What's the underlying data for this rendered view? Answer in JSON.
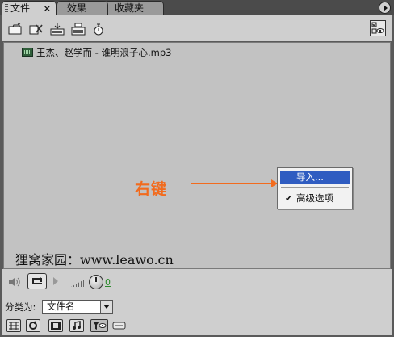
{
  "tabs": [
    {
      "label": "文件",
      "close": "×",
      "active": true
    },
    {
      "label": "效果",
      "active": false
    },
    {
      "label": "收藏夹",
      "active": false
    }
  ],
  "toolbar": {
    "icons": [
      "open-folder-icon",
      "delete-file-icon",
      "import-icon",
      "export-icon",
      "timer-icon"
    ],
    "right_icon": "view-options-icon"
  },
  "files": [
    {
      "name": "王杰、赵学而 - 谁明浪子心.mp3",
      "icon": "audio-file-icon"
    }
  ],
  "annotation": {
    "text": "右键",
    "color": "#f26b1d"
  },
  "context_menu": {
    "items": [
      {
        "label": "导入...",
        "selected": true
      },
      {
        "label": "高级选项",
        "checked": true,
        "check": "✔"
      }
    ]
  },
  "watermark": "狸窝家园：www.leawo.cn",
  "player": {
    "level": "0"
  },
  "sort": {
    "label": "分类为:",
    "value": "文件名"
  },
  "bottom_icons": [
    "grid-view-icon",
    "refresh-icon",
    "film-icon",
    "music-icon",
    "filter-icon",
    "extra-icon"
  ],
  "colors": {
    "accent": "#f26b1d",
    "selection": "#2f5cc1",
    "panel": "#cfcfcf",
    "list": "#c2c2c2"
  }
}
